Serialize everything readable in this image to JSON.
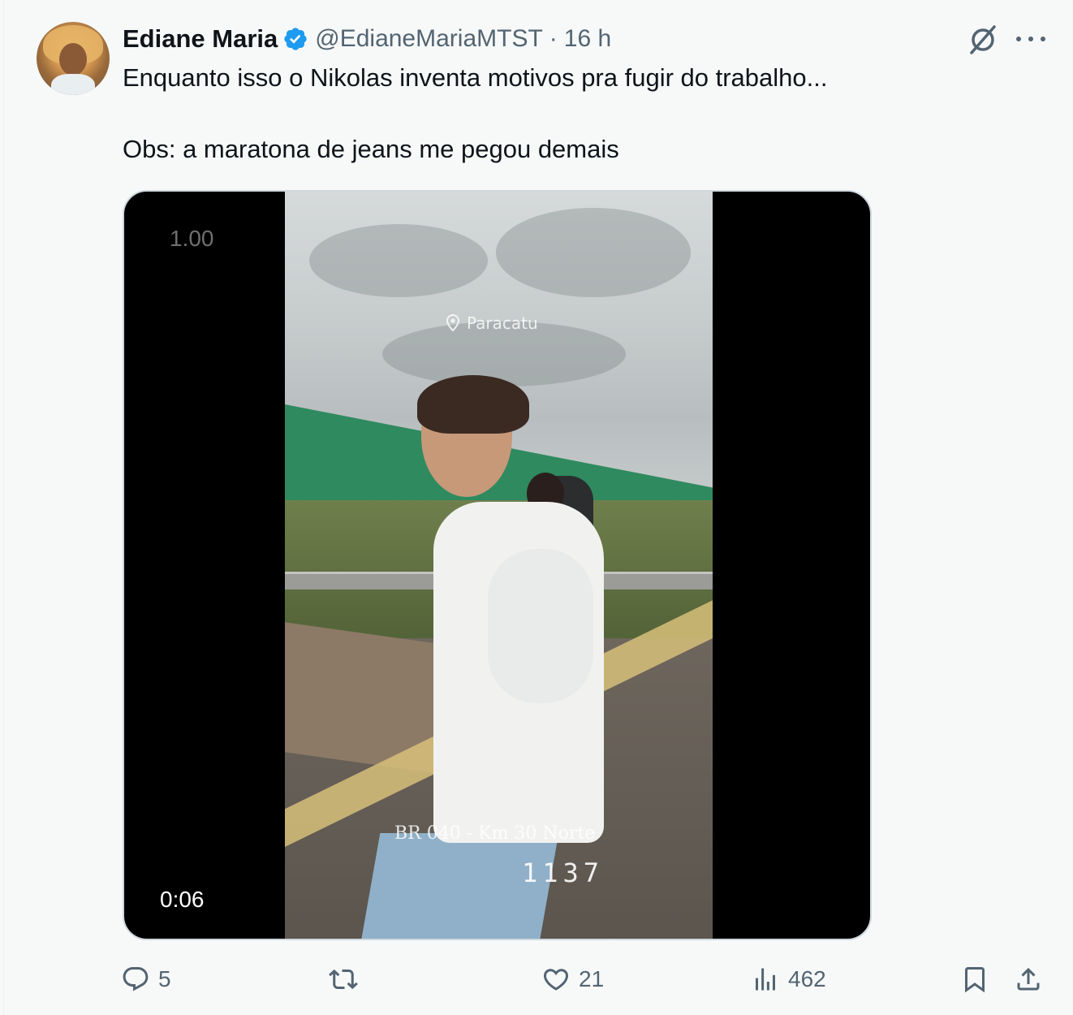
{
  "tweet": {
    "author_name": "Ediane Maria",
    "handle": "@EdianeMariaMTST",
    "separator": "·",
    "time": "16 h",
    "text_line1": "Enquanto isso o Nikolas inventa motivos pra fugir do trabalho...",
    "text_line2": "Obs: a maratona de jeans me pegou demais"
  },
  "video": {
    "speed": "1.00",
    "duration": "0:06",
    "overlay_location": "Paracatu",
    "overlay_road": "BR 040 - Km 30 Norte",
    "overlay_number": "1137"
  },
  "actions": {
    "replies": "5",
    "retweets": "",
    "likes": "21",
    "views": "462"
  },
  "icons": {
    "verified": "verified-badge-icon",
    "grok": "grok-icon",
    "more": "more-icon",
    "reply": "reply-icon",
    "retweet": "retweet-icon",
    "like": "like-icon",
    "views": "views-icon",
    "bookmark": "bookmark-icon",
    "share": "share-icon"
  },
  "colors": {
    "verified_blue": "#1d9bf0",
    "secondary_text": "#536471",
    "primary_text": "#0f1419"
  }
}
